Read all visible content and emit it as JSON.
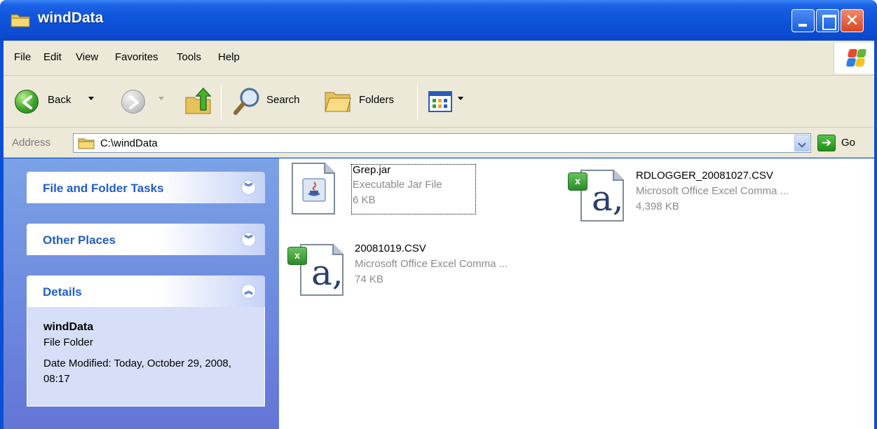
{
  "window": {
    "title": "windData"
  },
  "menu": [
    "File",
    "Edit",
    "View",
    "Favorites",
    "Tools",
    "Help"
  ],
  "toolbar": {
    "back_label": "Back",
    "search_label": "Search",
    "folders_label": "Folders"
  },
  "address": {
    "label": "Address",
    "value": "C:\\windData",
    "go_label": "Go"
  },
  "tasks": {
    "file_folder_tasks": "File and Folder Tasks",
    "other_places": "Other Places",
    "details": {
      "title": "Details",
      "name": "windData",
      "type": "File Folder",
      "modified": "Date Modified: Today, October 29, 2008, 08:17"
    }
  },
  "files": [
    {
      "name": "Grep.jar",
      "type": "Executable Jar File",
      "size": "6 KB",
      "icon": "java-jar-icon"
    },
    {
      "name": "RDLOGGER_20081027.CSV",
      "type": "Microsoft Office Excel Comma ...",
      "size": "4,398 KB",
      "icon": "excel-csv-icon"
    },
    {
      "name": "20081019.CSV",
      "type": "Microsoft Office Excel Comma ...",
      "size": "74 KB",
      "icon": "excel-csv-icon"
    }
  ],
  "colors": {
    "titlebar": "#0c4cd2",
    "taskpane": "#6f8ee0",
    "accent_text": "#215dc6"
  }
}
